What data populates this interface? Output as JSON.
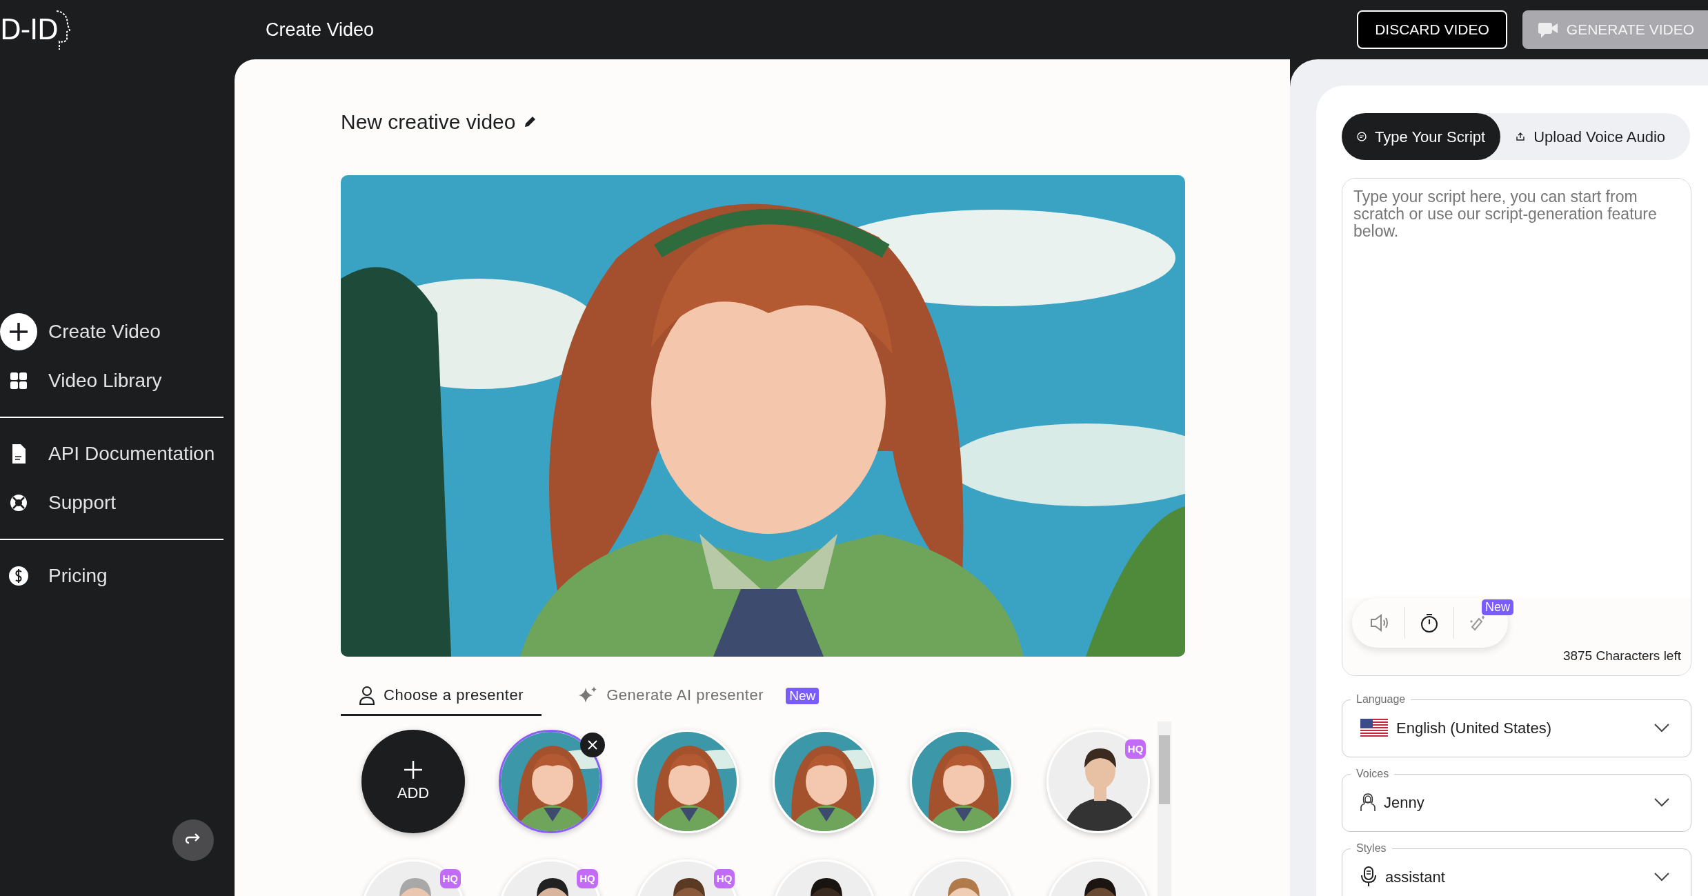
{
  "logo": "D-ID",
  "header": {
    "title": "Create Video",
    "buttons": [
      {
        "label": "DISCARD VIDEO",
        "kind": "outline",
        "disabled": false
      },
      {
        "label": "GENERATE VIDEO",
        "kind": "filled",
        "disabled": true
      }
    ]
  },
  "sidebar": {
    "sections": [
      [
        {
          "label": "Create Video",
          "kind": "plus"
        },
        {
          "label": "Video Library",
          "kind": "grid"
        }
      ],
      [
        {
          "label": "API Documentation",
          "kind": "doc"
        },
        {
          "label": "Support",
          "kind": "lifebuoy"
        }
      ],
      [
        {
          "label": "Pricing",
          "kind": "dollar"
        }
      ]
    ]
  },
  "video": {
    "title": "New creative video"
  },
  "presenter_tabs": [
    {
      "label": "Choose a presenter",
      "kind": "person",
      "selected": true
    },
    {
      "label": "Generate AI presenter",
      "kind": "sparkle",
      "selected": false,
      "badge": "New"
    }
  ],
  "presenters": [
    {
      "kind": "add",
      "label": "ADD"
    },
    {
      "kind": "anime",
      "selected": true
    },
    {
      "kind": "anime",
      "selected": false
    },
    {
      "kind": "anime",
      "selected": false
    },
    {
      "kind": "anime",
      "selected": false
    },
    {
      "kind": "person",
      "selected": false,
      "badge": "HQ"
    },
    {
      "kind": "person",
      "selected": false,
      "badge": "HQ"
    },
    {
      "kind": "person",
      "selected": false,
      "badge": "HQ"
    },
    {
      "kind": "person",
      "selected": false,
      "badge": "HQ"
    },
    {
      "kind": "person",
      "selected": false
    },
    {
      "kind": "person",
      "selected": false
    },
    {
      "kind": "person",
      "selected": false
    }
  ],
  "script": {
    "tabs": [
      {
        "label": "Type Your Script",
        "kind": "chat",
        "selected": true
      },
      {
        "label": "Upload Voice Audio",
        "kind": "upload",
        "selected": false
      }
    ],
    "placeholder": "Type your script here, you can start from scratch or use our script-generation feature below.",
    "tools_badge": "New",
    "chars_left": "3875 Characters left"
  },
  "fields": [
    {
      "label": "Language",
      "value": "English (United States)",
      "kind": "flag"
    },
    {
      "label": "Voices",
      "value": "Jenny",
      "kind": "voice"
    },
    {
      "label": "Styles",
      "value": "assistant",
      "kind": "mic"
    }
  ]
}
